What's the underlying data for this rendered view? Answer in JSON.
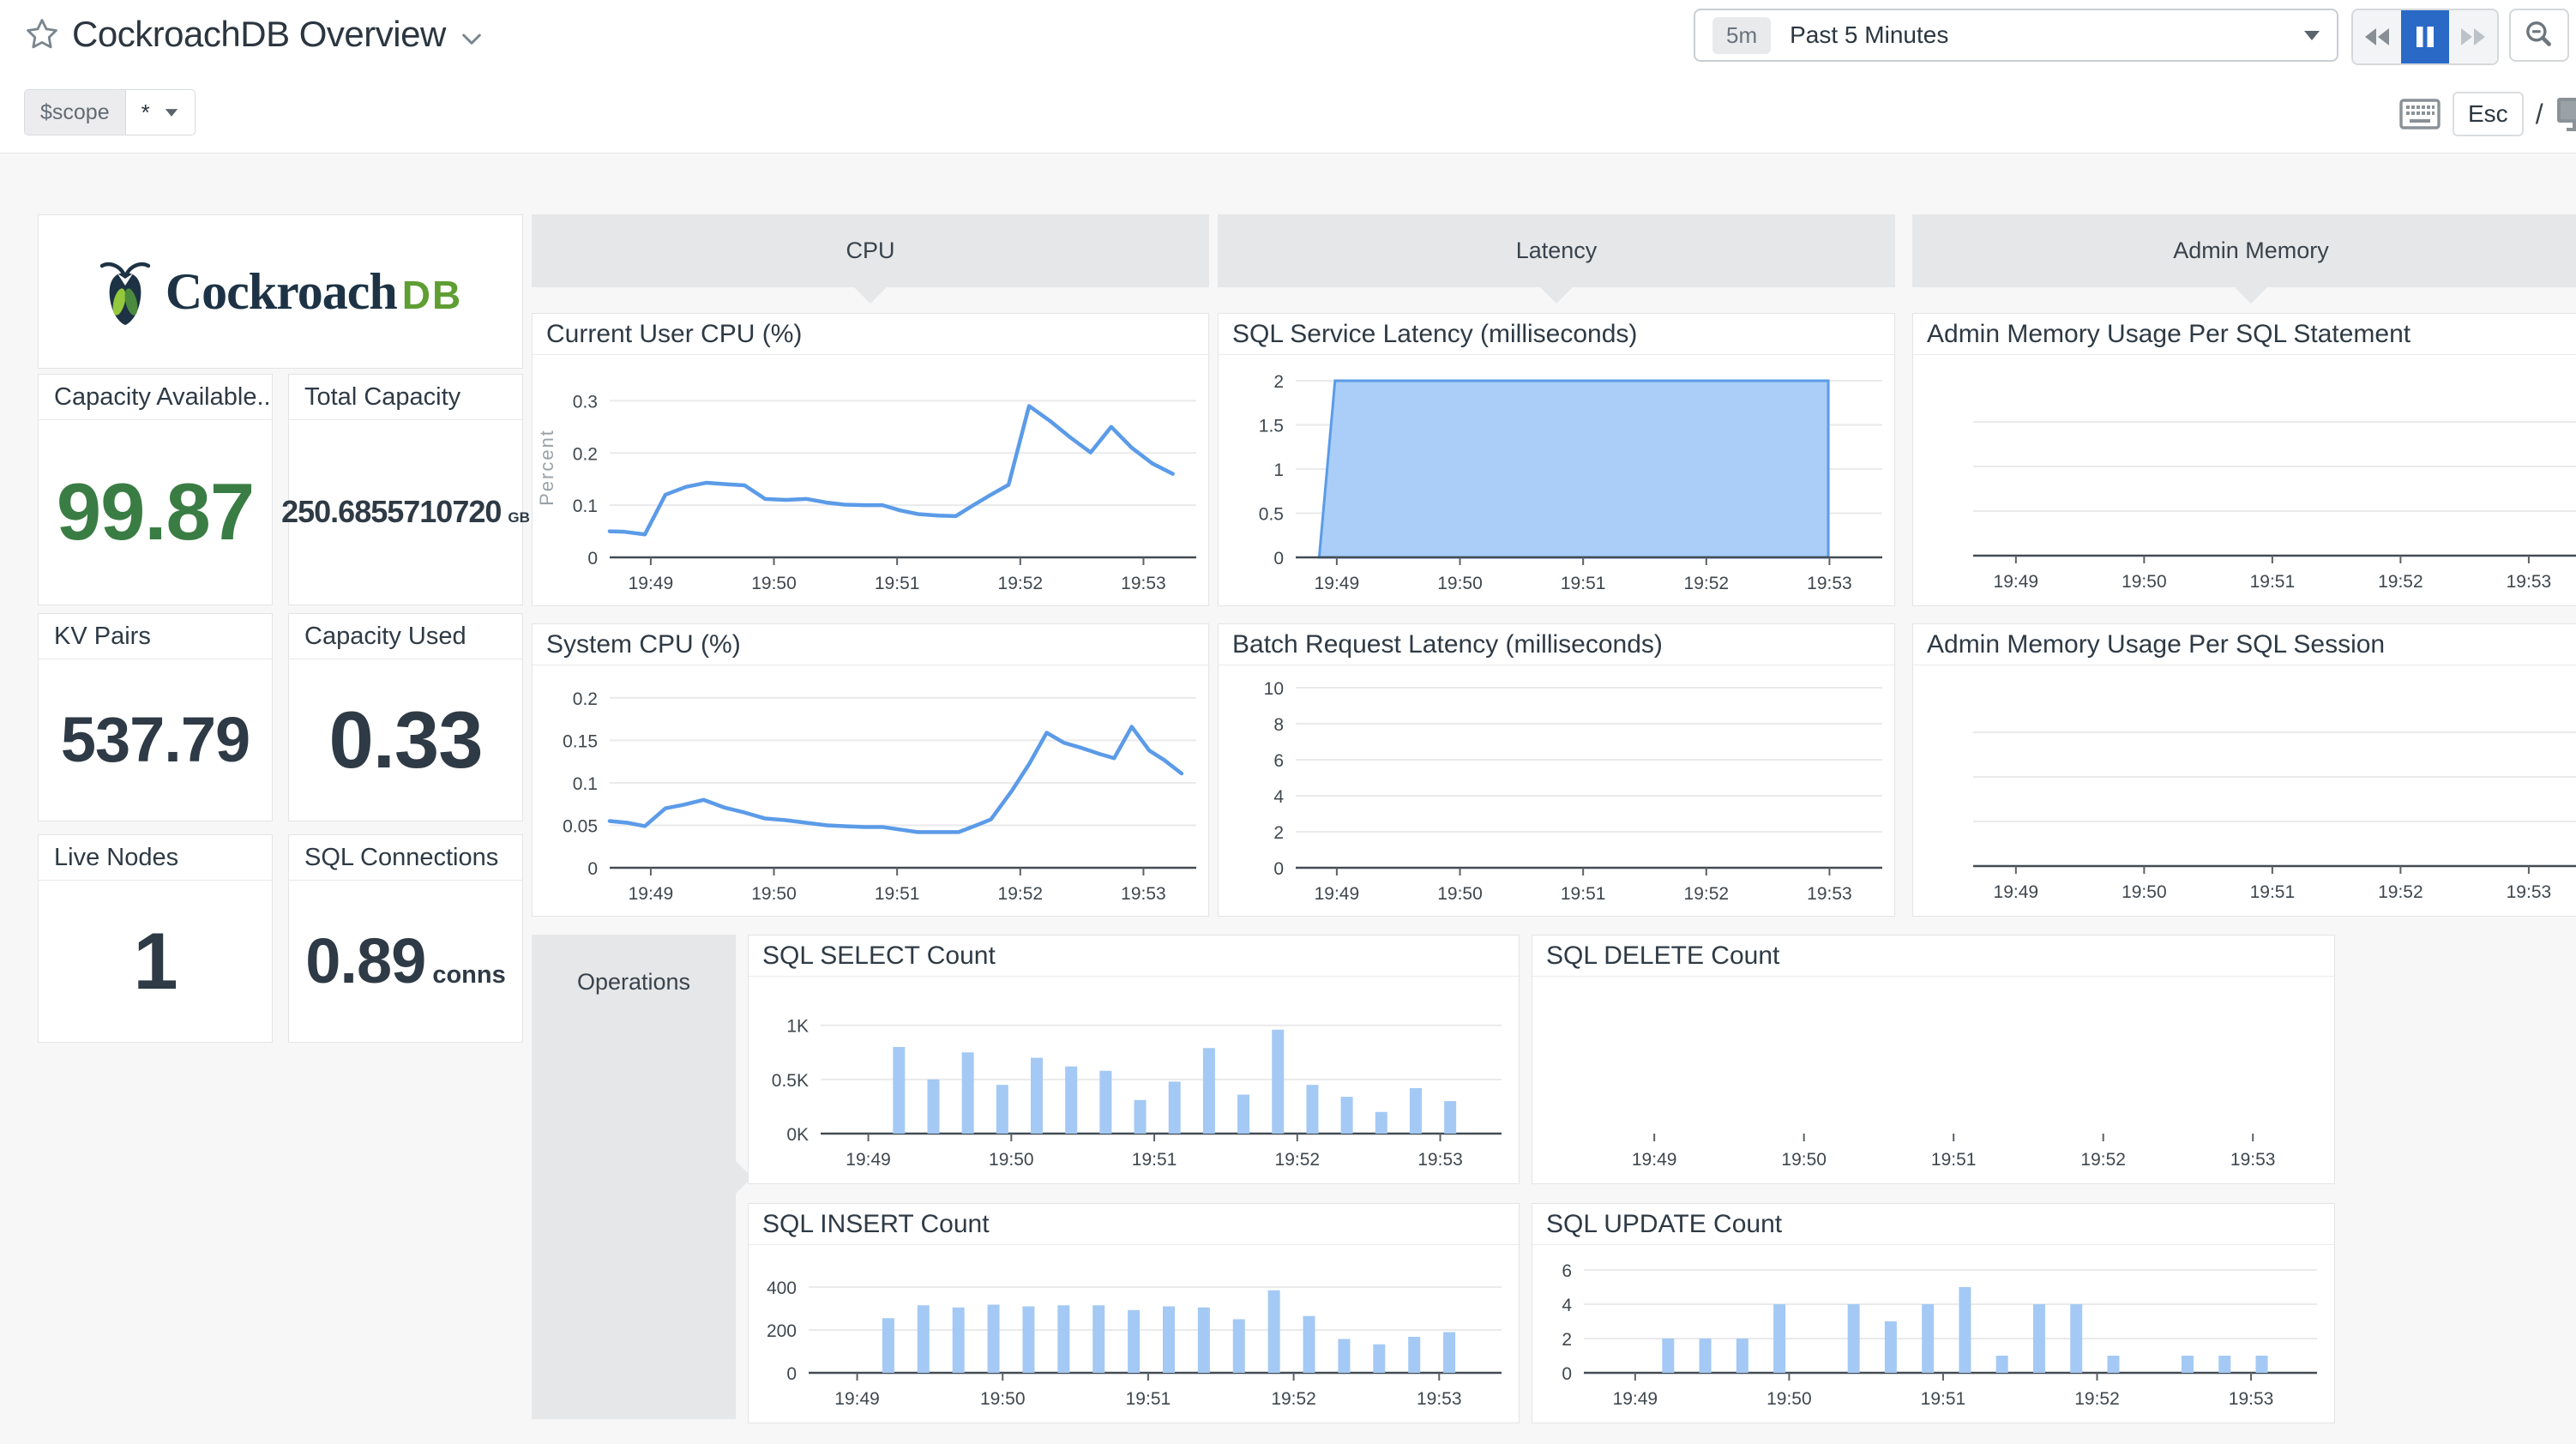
{
  "header": {
    "title": "CockroachDB Overview",
    "scope_label": "$scope",
    "scope_value": "*",
    "time_badge": "5m",
    "time_label": "Past 5 Minutes",
    "esc_label": "Esc",
    "slash": "/"
  },
  "logo": {
    "brand": "Cockroach",
    "suffix": "DB"
  },
  "colors": {
    "line_blue": "#5b9be8",
    "area_fill": "#aacef7",
    "bar_fill": "#a4c9f4",
    "green": "#3a7d44",
    "dark": "#2e3a45",
    "pause_blue": "#2a6ac6",
    "group_gray": "#e6e7e8"
  },
  "cards": [
    {
      "title": "Capacity Available...",
      "value": "99.87",
      "unit": ""
    },
    {
      "title": "Total Capacity",
      "value": "250.6855710720",
      "unit": "GB"
    },
    {
      "title": "KV Pairs",
      "value": "537.79",
      "unit": ""
    },
    {
      "title": "Capacity Used",
      "value": "0.33",
      "unit": ""
    },
    {
      "title": "Live Nodes",
      "value": "1",
      "unit": ""
    },
    {
      "title": "SQL Connections",
      "value": "0.89",
      "unit": "conns"
    }
  ],
  "groups": [
    {
      "label": "CPU"
    },
    {
      "label": "Latency"
    },
    {
      "label": "Admin Memory"
    },
    {
      "label": "Operations"
    }
  ],
  "axis": {
    "xticks": [
      "19:49",
      "19:50",
      "19:51",
      "19:52",
      "19:53"
    ],
    "xf": [
      0.07,
      0.28,
      0.49,
      0.7,
      0.91
    ]
  },
  "charts": [
    {
      "title": "Current User CPU (%)",
      "kind": "line",
      "ylabel": "Percent",
      "ymax": 0.345,
      "m": [
        26,
        14,
        56,
        90
      ],
      "yticks": [
        {
          "v": 0,
          "l": "0"
        },
        {
          "v": 0.1,
          "l": "0.1"
        },
        {
          "v": 0.2,
          "l": "0.2"
        },
        {
          "v": 0.3,
          "l": "0.3"
        }
      ],
      "points": [
        [
          0.0,
          0.05
        ],
        [
          0.025,
          0.049
        ],
        [
          0.06,
          0.044
        ],
        [
          0.095,
          0.12
        ],
        [
          0.13,
          0.135
        ],
        [
          0.165,
          0.143
        ],
        [
          0.2,
          0.14
        ],
        [
          0.23,
          0.138
        ],
        [
          0.265,
          0.112
        ],
        [
          0.3,
          0.11
        ],
        [
          0.335,
          0.112
        ],
        [
          0.37,
          0.105
        ],
        [
          0.4,
          0.101
        ],
        [
          0.435,
          0.1
        ],
        [
          0.465,
          0.1
        ],
        [
          0.495,
          0.09
        ],
        [
          0.525,
          0.083
        ],
        [
          0.56,
          0.08
        ],
        [
          0.59,
          0.079
        ],
        [
          0.62,
          0.1
        ],
        [
          0.65,
          0.12
        ],
        [
          0.68,
          0.139
        ],
        [
          0.715,
          0.29
        ],
        [
          0.75,
          0.262
        ],
        [
          0.785,
          0.23
        ],
        [
          0.82,
          0.201
        ],
        [
          0.855,
          0.25
        ],
        [
          0.89,
          0.21
        ],
        [
          0.925,
          0.18
        ],
        [
          0.96,
          0.16
        ]
      ]
    },
    {
      "title": "System CPU (%)",
      "kind": "line",
      "ymax": 0.212,
      "m": [
        26,
        14,
        56,
        90
      ],
      "yticks": [
        {
          "v": 0,
          "l": "0"
        },
        {
          "v": 0.05,
          "l": "0.05"
        },
        {
          "v": 0.1,
          "l": "0.1"
        },
        {
          "v": 0.15,
          "l": "0.15"
        },
        {
          "v": 0.2,
          "l": "0.2"
        }
      ],
      "points": [
        [
          0.0,
          0.055
        ],
        [
          0.03,
          0.053
        ],
        [
          0.06,
          0.049
        ],
        [
          0.095,
          0.07
        ],
        [
          0.125,
          0.074
        ],
        [
          0.16,
          0.08
        ],
        [
          0.195,
          0.071
        ],
        [
          0.23,
          0.065
        ],
        [
          0.265,
          0.058
        ],
        [
          0.3,
          0.056
        ],
        [
          0.335,
          0.053
        ],
        [
          0.37,
          0.05
        ],
        [
          0.4,
          0.049
        ],
        [
          0.435,
          0.048
        ],
        [
          0.465,
          0.048
        ],
        [
          0.495,
          0.045
        ],
        [
          0.525,
          0.042
        ],
        [
          0.56,
          0.042
        ],
        [
          0.595,
          0.042
        ],
        [
          0.625,
          0.05
        ],
        [
          0.65,
          0.057
        ],
        [
          0.685,
          0.09
        ],
        [
          0.715,
          0.122
        ],
        [
          0.745,
          0.159
        ],
        [
          0.775,
          0.147
        ],
        [
          0.805,
          0.141
        ],
        [
          0.835,
          0.134
        ],
        [
          0.86,
          0.129
        ],
        [
          0.89,
          0.166
        ],
        [
          0.92,
          0.138
        ],
        [
          0.945,
          0.127
        ],
        [
          0.975,
          0.111
        ]
      ]
    },
    {
      "title": "SQL Service Latency (milliseconds)",
      "kind": "area",
      "ymax": 2,
      "m": [
        30,
        14,
        56,
        90
      ],
      "yticks": [
        {
          "v": 0,
          "l": "0"
        },
        {
          "v": 0.5,
          "l": "0.5"
        },
        {
          "v": 1,
          "l": "1"
        },
        {
          "v": 1.5,
          "l": "1.5"
        },
        {
          "v": 2,
          "l": "2"
        }
      ],
      "points": [
        [
          0.04,
          0
        ],
        [
          0.067,
          2
        ],
        [
          0.908,
          2
        ],
        [
          0.908,
          0
        ]
      ]
    },
    {
      "title": "Batch Request Latency (milliseconds)",
      "kind": "none",
      "ymax": 10,
      "m": [
        26,
        14,
        56,
        90
      ],
      "yticks": [
        {
          "v": 0,
          "l": "0"
        },
        {
          "v": 2,
          "l": "2"
        },
        {
          "v": 4,
          "l": "4"
        },
        {
          "v": 6,
          "l": "6"
        },
        {
          "v": 8,
          "l": "8"
        },
        {
          "v": 10,
          "l": "10"
        }
      ]
    },
    {
      "title": "Admin Memory Usage Per SQL Statement",
      "kind": "none",
      "ymax": 4,
      "m": [
        26,
        6,
        58,
        70
      ],
      "yticks": [
        {
          "v": 1
        },
        {
          "v": 2
        },
        {
          "v": 3
        }
      ]
    },
    {
      "title": "Admin Memory Usage Per SQL Session",
      "kind": "none",
      "ymax": 4,
      "m": [
        26,
        6,
        58,
        70
      ],
      "yticks": [
        {
          "v": 1
        },
        {
          "v": 2
        },
        {
          "v": 3
        }
      ]
    },
    {
      "title": "SQL SELECT Count",
      "kind": "bars",
      "ymax": 1180,
      "m": [
        34,
        20,
        58,
        84
      ],
      "yticks": [
        {
          "v": 0,
          "l": "0K"
        },
        {
          "v": 500,
          "l": "0.5K"
        },
        {
          "v": 1000,
          "l": "1K"
        }
      ],
      "values": [
        800,
        500,
        750,
        450,
        700,
        620,
        580,
        310,
        480,
        790,
        360,
        960,
        450,
        340,
        200,
        420,
        300
      ]
    },
    {
      "title": "SQL DELETE Count",
      "kind": "none",
      "ymax": 10,
      "baseline": false,
      "m": [
        26,
        20,
        58,
        84
      ],
      "yticks": []
    },
    {
      "title": "SQL INSERT Count",
      "kind": "bars",
      "ymax": 460,
      "m": [
        34,
        20,
        58,
        70
      ],
      "yticks": [
        {
          "v": 0,
          "l": "0"
        },
        {
          "v": 200,
          "l": "200"
        },
        {
          "v": 400,
          "l": "400"
        }
      ],
      "values": [
        255,
        315,
        305,
        318,
        310,
        315,
        315,
        293,
        310,
        305,
        250,
        385,
        265,
        158,
        133,
        168,
        190
      ]
    },
    {
      "title": "SQL UPDATE Count",
      "kind": "bars",
      "ymax": 6.15,
      "m": [
        26,
        20,
        58,
        60
      ],
      "yticks": [
        {
          "v": 0,
          "l": "0"
        },
        {
          "v": 2,
          "l": "2"
        },
        {
          "v": 4,
          "l": "4"
        },
        {
          "v": 6,
          "l": "6"
        }
      ],
      "values": [
        2,
        2,
        2,
        4,
        0,
        4,
        3,
        4,
        5,
        1,
        4,
        4,
        1,
        0,
        1,
        1,
        1
      ]
    }
  ]
}
